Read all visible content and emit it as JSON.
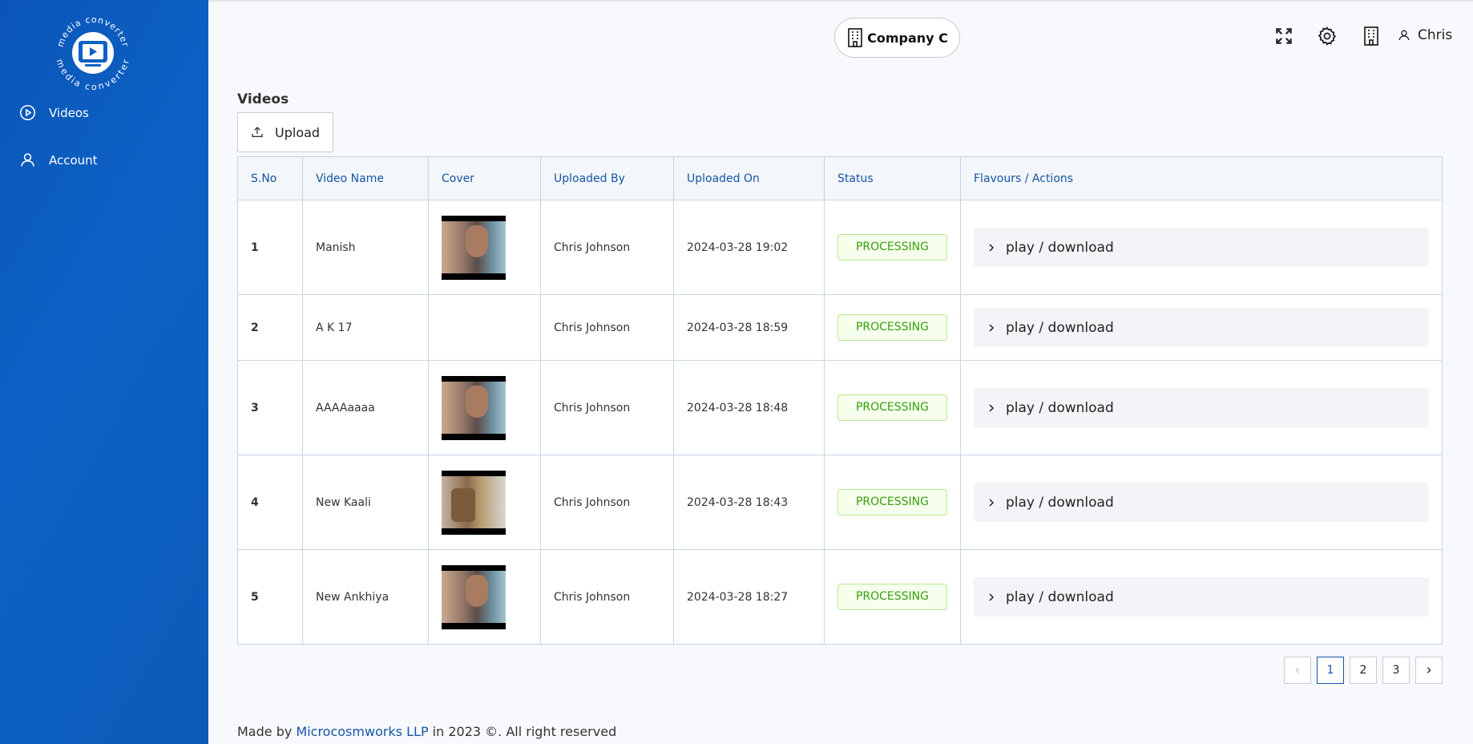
{
  "logo": {
    "ring_text_top": "media converter",
    "ring_text_bottom": "media converter"
  },
  "sidebar": {
    "items": [
      {
        "label": "Videos",
        "icon": "play-circle-icon"
      },
      {
        "label": "Account",
        "icon": "user-icon"
      }
    ]
  },
  "header": {
    "company": "Company C",
    "user": "Chris",
    "icons": [
      "fullscreen-icon",
      "gear-icon",
      "building-icon",
      "user-icon"
    ]
  },
  "page": {
    "title": "Videos",
    "upload_label": "Upload"
  },
  "table": {
    "headers": [
      "S.No",
      "Video Name",
      "Cover",
      "Uploaded By",
      "Uploaded On",
      "Status",
      "Flavours / Actions"
    ],
    "rows": [
      {
        "sno": "1",
        "name": "Manish",
        "cover": "true",
        "by": "Chris Johnson",
        "on": "2024-03-28 19:02",
        "status": "PROCESSING",
        "action": "play / download"
      },
      {
        "sno": "2",
        "name": "A K 17",
        "cover": "false",
        "by": "Chris Johnson",
        "on": "2024-03-28 18:59",
        "status": "PROCESSING",
        "action": "play / download"
      },
      {
        "sno": "3",
        "name": "AAAAaaaa",
        "cover": "true",
        "by": "Chris Johnson",
        "on": "2024-03-28 18:48",
        "status": "PROCESSING",
        "action": "play / download"
      },
      {
        "sno": "4",
        "name": "New Kaali",
        "cover": "true",
        "by": "Chris Johnson",
        "on": "2024-03-28 18:43",
        "status": "PROCESSING",
        "action": "play / download"
      },
      {
        "sno": "5",
        "name": "New Ankhiya",
        "cover": "true",
        "by": "Chris Johnson",
        "on": "2024-03-28 18:27",
        "status": "PROCESSING",
        "action": "play / download"
      }
    ]
  },
  "pagination": {
    "pages": [
      "1",
      "2",
      "3"
    ],
    "current": "1"
  },
  "footer": {
    "prefix": "Made by ",
    "company": "Microcosmworks LLP",
    "suffix": " in 2023 ©. All right reserved"
  },
  "colors": {
    "sidebar": "#0a55b8",
    "accent": "#1456a4",
    "status_green": "#389e0d"
  }
}
